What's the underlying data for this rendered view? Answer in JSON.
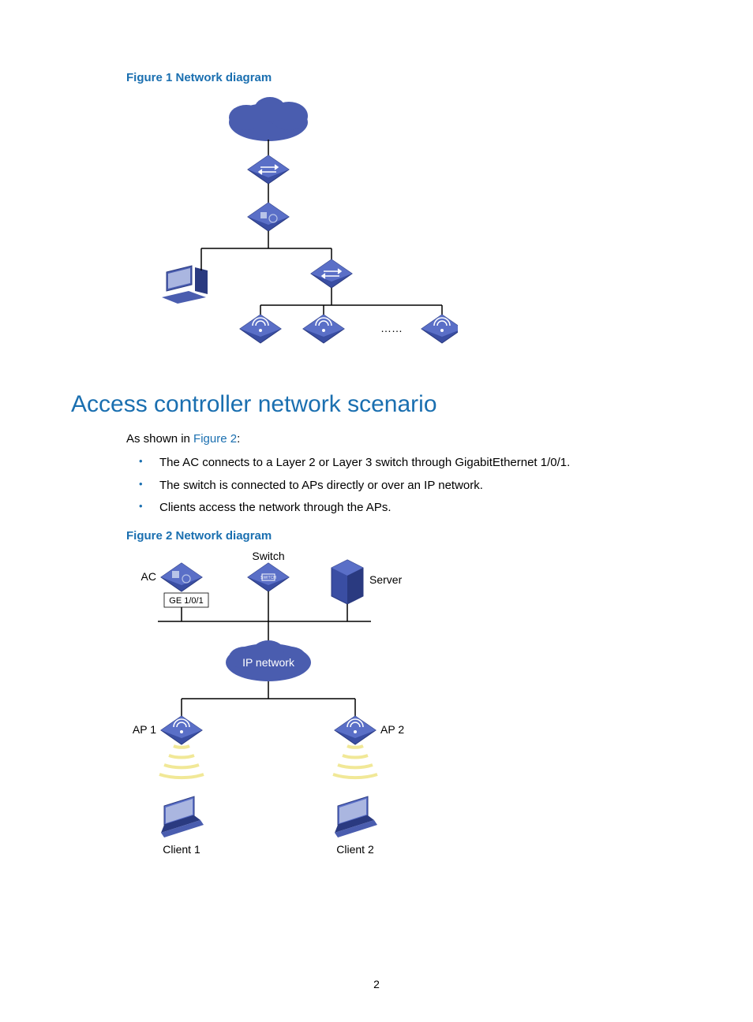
{
  "figure1": {
    "caption": "Figure 1 Network diagram",
    "ellipsis": "……"
  },
  "heading": "Access controller network scenario",
  "intro": {
    "prefix": "As shown in ",
    "link": "Figure 2",
    "suffix": ":"
  },
  "bullets": [
    "The AC connects to a Layer 2 or Layer 3 switch through GigabitEthernet 1/0/1.",
    "The switch is connected to APs directly or over an IP network.",
    "Clients access the network through the APs."
  ],
  "figure2": {
    "caption": "Figure 2 Network diagram",
    "labels": {
      "ac": "AC",
      "ge": "GE 1/0/1",
      "switch": "Switch",
      "server": "Server",
      "ipnet": "IP network",
      "ap1": "AP 1",
      "ap2": "AP 2",
      "c1": "Client 1",
      "c2": "Client 2"
    }
  },
  "pageNumber": "2"
}
